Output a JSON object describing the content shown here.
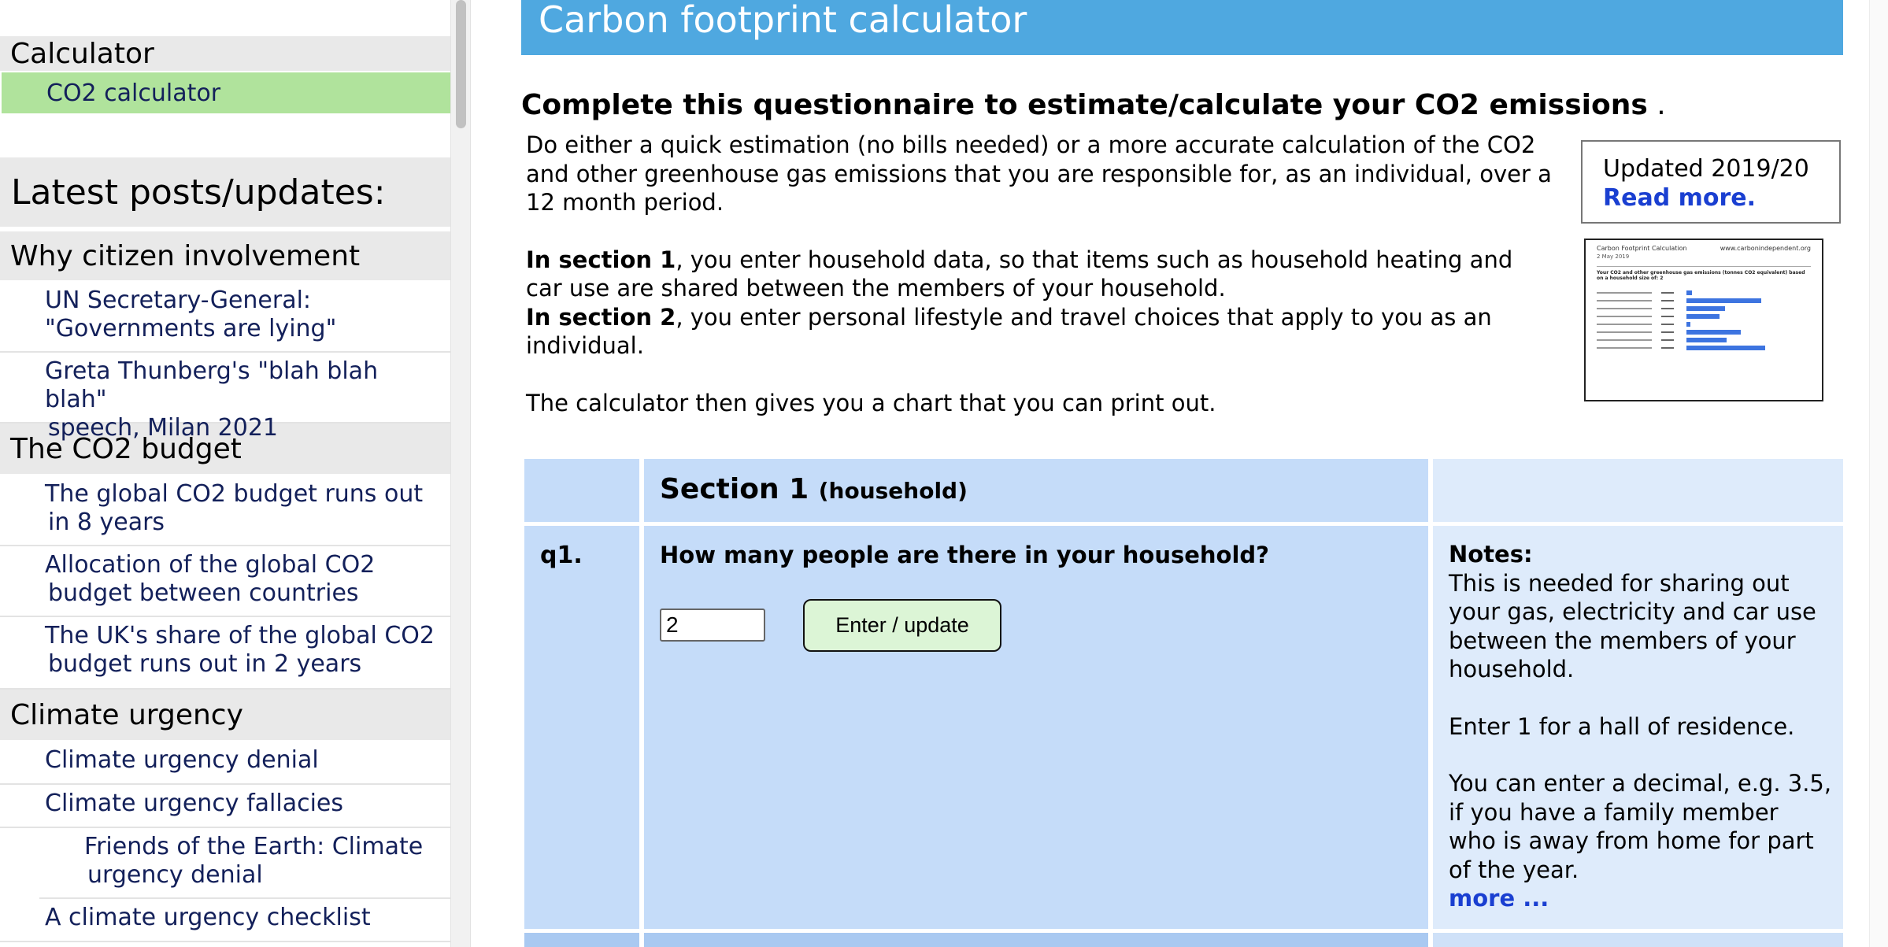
{
  "sidebar": {
    "calculator_heading": "Calculator",
    "selected_item": "CO2 calculator",
    "latest_heading": "Latest posts/updates:",
    "groups": [
      {
        "heading": "Why citizen involvement",
        "items": [
          {
            "line1": "UN Secretary-General:",
            "line2": "\"Governments are lying\""
          },
          {
            "line1": "Greta Thunberg's \"blah blah blah\"",
            "line2": "speech, Milan 2021"
          }
        ]
      },
      {
        "heading": "The CO2 budget",
        "items": [
          {
            "line1": "The global CO2 budget runs out",
            "line2": "in 8 years"
          },
          {
            "line1": "Allocation of the global CO2",
            "line2": "budget between countries"
          },
          {
            "line1": "The UK's share of the global CO2",
            "line2": "budget runs out in 2 years"
          }
        ]
      },
      {
        "heading": "Climate urgency",
        "items": [
          {
            "line1": "Climate urgency denial"
          },
          {
            "line1": "Climate urgency fallacies"
          },
          {
            "line1": "Friends of the Earth: Climate",
            "line2": "urgency denial"
          },
          {
            "line1": "A climate urgency checklist"
          }
        ]
      }
    ]
  },
  "main": {
    "banner_title": "Carbon footprint calculator",
    "intro_title": "Complete this questionnaire to estimate/calculate your CO2 emissions",
    "intro_title_suffix": " .",
    "intro_p1": "Do either a quick estimation (no bills needed) or a more accurate calculation of the CO2 and other greenhouse gas emissions that you are responsible for, as an individual, over a 12 month period.",
    "intro_s1_bold": "In section 1",
    "intro_s1_rest": ", you enter household data, so that items such as household heating and car use are shared between the members of your household.",
    "intro_s2_bold": "In section 2",
    "intro_s2_rest": ", you enter personal lifestyle and travel choices that apply to you as an individual.",
    "intro_p3": "The calculator then gives you a chart that you can print out.",
    "updated_label": "Updated 2019/20",
    "read_more": "Read more.",
    "thumbnail": {
      "title": "Carbon Footprint Calculation",
      "site": "www.carbonindependent.org",
      "date": "2 May 2019",
      "subtitle": "Your CO2 and other greenhouse gas emissions (tonnes CO2 equivalent) based on a household size of: 2",
      "bar_values": [
        0.11,
        1.52,
        0.78,
        0.67,
        0.08,
        1.1,
        0.82,
        1.6
      ]
    }
  },
  "section1": {
    "heading": "Section 1",
    "heading_small": "(household)",
    "q_number": "q1.",
    "question": "How many people are there in your household?",
    "input_value": "2",
    "button_label": "Enter / update",
    "notes_label": "Notes:",
    "notes_p1": "This is needed for sharing out your gas, electricity and car use between the members of your household.",
    "notes_p2": "Enter 1 for a hall of residence.",
    "notes_p3": "You can enter a decimal, e.g. 3.5, if you have a family member who is away from home for part of the year.",
    "notes_more": "more ..."
  }
}
